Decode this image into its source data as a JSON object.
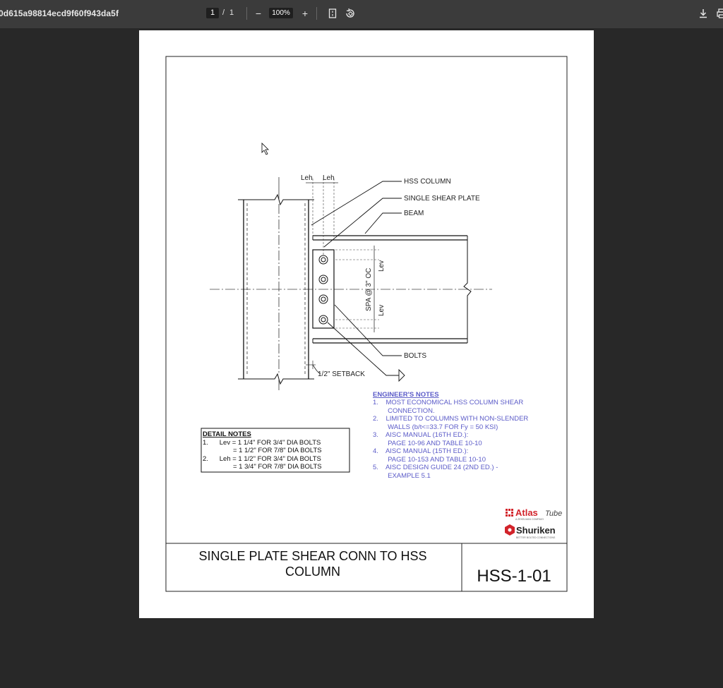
{
  "toolbar": {
    "doc_title": "0d615a98814ecd9f60f943da5f",
    "page_current": "1",
    "page_sep": "/",
    "page_total": "1",
    "zoom_out": "−",
    "zoom": "100%",
    "zoom_in": "+",
    "icons": [
      "fit-page-icon",
      "rotate-icon",
      "download-icon",
      "print-icon"
    ]
  },
  "drawing": {
    "labels": {
      "leh1": "Leh",
      "leh2": "Leh",
      "hss_column": "HSS COLUMN",
      "single_shear_plate": "SINGLE SHEAR PLATE",
      "beam": "BEAM",
      "lev_top": "Lev",
      "spacing": "SPA @ 3\" OC",
      "lev_bottom": "Lev",
      "bolts": "BOLTS",
      "setback": "1/2\" SETBACK"
    },
    "engineers_notes": {
      "heading": "ENGINEER'S NOTES",
      "lines": [
        "1.    MOST ECONOMICAL HSS COLUMN SHEAR",
        "        CONNECTION.",
        "2.    LIMITED TO COLUMNS WITH NON-SLENDER",
        "        WALLS (b/t<=33.7 FOR Fy = 50 KSI)",
        "3.    AISC MANUAL (16TH ED.):",
        "        PAGE 10-96 AND TABLE 10-10",
        "4.    AISC MANUAL (15TH ED.):",
        "        PAGE 10-153 AND TABLE 10-10",
        "5.    AISC DESIGN GUIDE 24 (2ND ED.) -",
        "        EXAMPLE 5.1"
      ]
    },
    "detail_notes": {
      "heading": "DETAIL NOTES",
      "lines": [
        "1.      Lev = 1 1/4\" FOR 3/4\" DIA BOLTS",
        "= 1 1/2\" FOR 7/8\" DIA BOLTS",
        "2.      Leh = 1 1/2\" FOR 3/4\" DIA BOLTS",
        "= 1 3/4\" FOR 7/8\" DIA BOLTS"
      ]
    },
    "logos": {
      "atlas": "Atlas",
      "atlas_tube": "Tube",
      "atlas_sub": "A ZEKELMAN COMPANY",
      "shuriken": "Shuriken",
      "shuriken_sub": "BETTER BOLTED CONNECTIONS",
      "brand_color": "#d2232a"
    },
    "title_block": {
      "title_line1": "SINGLE PLATE SHEAR CONN TO HSS",
      "title_line2": "COLUMN",
      "drawing_number": "HSS-1-01"
    }
  }
}
